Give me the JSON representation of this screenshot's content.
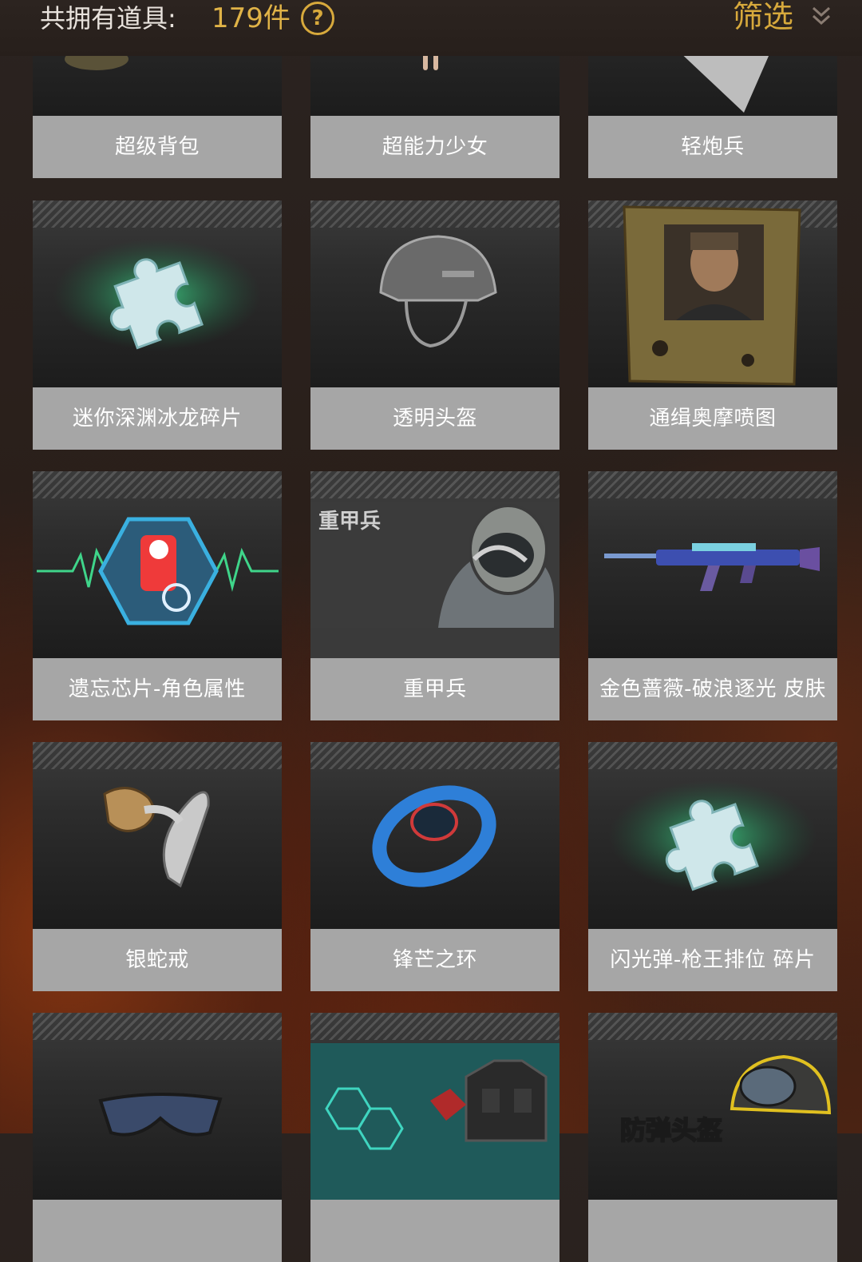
{
  "header": {
    "label": "共拥有道具:",
    "count": "179件",
    "help_icon": "question-circle-icon",
    "filter_label": "筛选",
    "filter_icon": "double-chevron-down-icon"
  },
  "items": [
    {
      "name": "超级背包",
      "icon": "backpack-icon"
    },
    {
      "name": "超能力少女",
      "icon": "character-icon"
    },
    {
      "name": "轻炮兵",
      "icon": "character-icon"
    },
    {
      "name": "迷你深渊冰龙碎片",
      "icon": "puzzle-piece-icon"
    },
    {
      "name": "透明头盔",
      "icon": "helmet-icon"
    },
    {
      "name": "通缉奥摩喷图",
      "icon": "wanted-poster-icon"
    },
    {
      "name": "遗忘芯片-角色属性",
      "icon": "chip-icon"
    },
    {
      "name": "重甲兵",
      "icon": "heavy-armor-icon",
      "image_text": "重甲兵"
    },
    {
      "name": "金色蔷薇-破浪逐光 皮肤",
      "icon": "rifle-icon"
    },
    {
      "name": "银蛇戒",
      "icon": "snake-ring-icon"
    },
    {
      "name": "锋芒之环",
      "icon": "ring-icon"
    },
    {
      "name": "闪光弹-枪王排位 碎片",
      "icon": "puzzle-piece-icon"
    },
    {
      "name": "",
      "icon": "goggles-icon"
    },
    {
      "name": "",
      "icon": "vest-icon"
    },
    {
      "name": "",
      "icon": "bulletproof-helmet-icon",
      "image_text": "防弹头盔"
    }
  ]
}
